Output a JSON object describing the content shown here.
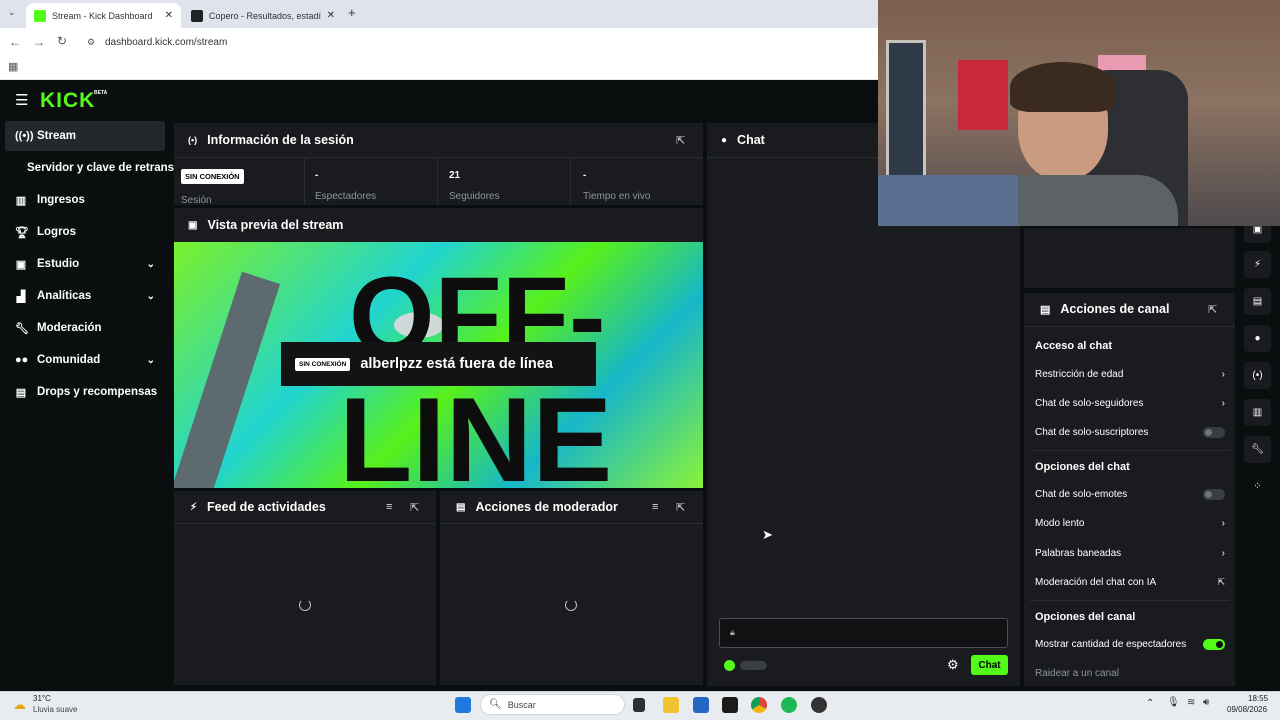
{
  "browser": {
    "tabs": [
      {
        "label": "Stream - Kick Dashboard",
        "active": true
      },
      {
        "label": "Copero - Resultados, estadística",
        "active": false
      }
    ],
    "url": "dashboard.kick.com/stream"
  },
  "app": {
    "logo": "KICK",
    "logo_tag": "BETA"
  },
  "sidebar": {
    "items": [
      {
        "label": "Stream",
        "icon": "broadcast-icon"
      },
      {
        "label": "Servidor y clave de retransm",
        "icon": ""
      },
      {
        "label": "Ingresos",
        "icon": "chart-icon"
      },
      {
        "label": "Logros",
        "icon": "trophy-icon"
      },
      {
        "label": "Estudio",
        "icon": "studio-icon"
      },
      {
        "label": "Analíticas",
        "icon": "analytics-icon"
      },
      {
        "label": "Moderación",
        "icon": "wrench-icon"
      },
      {
        "label": "Comunidad",
        "icon": "people-icon"
      },
      {
        "label": "Drops y recompensas",
        "icon": "gift-icon"
      }
    ]
  },
  "session": {
    "title": "Información de la sesión",
    "status_badge": "SIN CONEXIÓN",
    "status_label": "Sesión",
    "stats": [
      {
        "value": "-",
        "label": "Espectadores"
      },
      {
        "value": "21",
        "label": "Seguidores"
      },
      {
        "value": "-",
        "label": "Tiempo en vivo"
      }
    ]
  },
  "preview": {
    "title": "Vista previa del stream",
    "badge": "SIN CONEXIÓN",
    "message": "alberlpzz está fuera de línea",
    "bg_text_top": "OFF-",
    "bg_text_bottom": "LINE"
  },
  "feed": {
    "title": "Feed de actividades"
  },
  "modactions": {
    "title": "Acciones de moderador"
  },
  "chat": {
    "title": "Chat",
    "send_label": "Chat"
  },
  "channel_actions": {
    "title": "Acciones de canal",
    "sections": [
      {
        "heading": "Acceso al chat",
        "items": [
          {
            "label": "Restricción de edad",
            "control": "chevron"
          },
          {
            "label": "Chat de solo-seguidores",
            "control": "chevron"
          },
          {
            "label": "Chat de solo-suscriptores",
            "control": "toggle-off"
          }
        ]
      },
      {
        "heading": "Opciones del chat",
        "items": [
          {
            "label": "Chat de solo-emotes",
            "control": "toggle-off"
          },
          {
            "label": "Modo lento",
            "control": "chevron"
          },
          {
            "label": "Palabras baneadas",
            "control": "chevron"
          },
          {
            "label": "Moderación del chat con IA",
            "control": "external"
          }
        ]
      },
      {
        "heading": "Opciones del canal",
        "items": [
          {
            "label": "Mostrar cantidad de espectadores",
            "control": "toggle-on"
          },
          {
            "label": "Raidear a un canal",
            "control": "none"
          }
        ]
      }
    ]
  },
  "taskbar": {
    "weather_temp": "31°C",
    "weather_desc": "Lluvia suave",
    "search_placeholder": "Buscar",
    "time": "18:55",
    "date": "09/08/2026"
  },
  "colors": {
    "accent": "#53fc18",
    "panel": "#191b1f",
    "bg": "#0b0e0f"
  }
}
